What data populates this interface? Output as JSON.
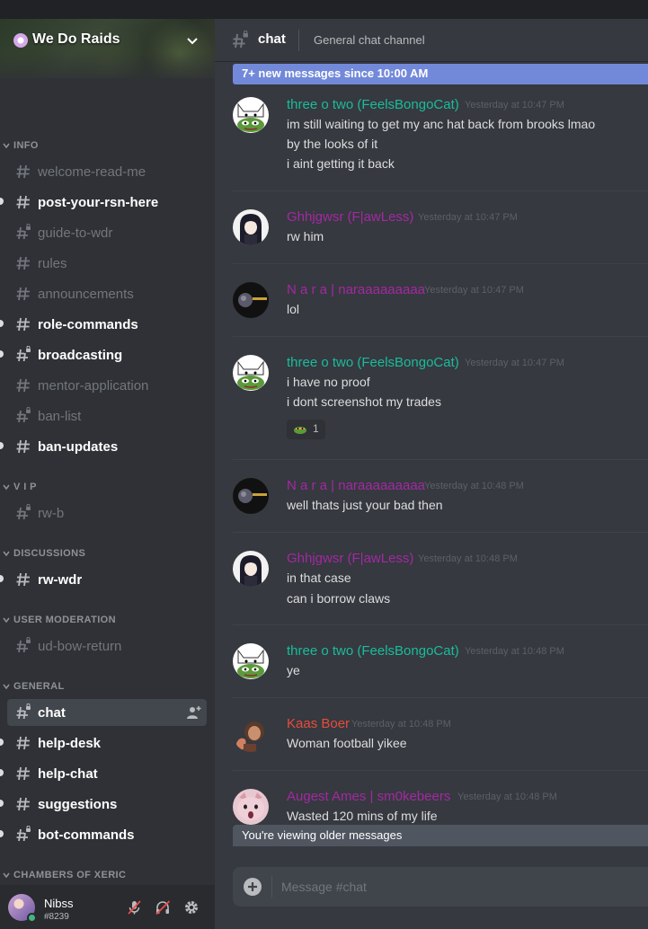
{
  "server": {
    "name": "We Do Raids"
  },
  "categories": [
    {
      "label": "INFO"
    },
    {
      "label": "V I P"
    },
    {
      "label": "DISCUSSIONS"
    },
    {
      "label": "USER MODERATION"
    },
    {
      "label": "GENERAL"
    },
    {
      "label": "CHAMBERS OF XERIC"
    }
  ],
  "channels": [
    {
      "name": "welcome-read-me",
      "unread": false
    },
    {
      "name": "post-your-rsn-here",
      "unread": true
    },
    {
      "name": "guide-to-wdr",
      "unread": false
    },
    {
      "name": "rules",
      "unread": false
    },
    {
      "name": "announcements",
      "unread": false
    },
    {
      "name": "role-commands",
      "unread": true
    },
    {
      "name": "broadcasting",
      "unread": true
    },
    {
      "name": "mentor-application",
      "unread": false
    },
    {
      "name": "ban-list",
      "unread": false
    },
    {
      "name": "ban-updates",
      "unread": true
    },
    {
      "name": "rw-b",
      "unread": false
    },
    {
      "name": "rw-wdr",
      "unread": true
    },
    {
      "name": "ud-bow-return",
      "unread": false
    },
    {
      "name": "chat",
      "unread": false,
      "selected": true
    },
    {
      "name": "help-desk",
      "unread": true
    },
    {
      "name": "help-chat",
      "unread": true
    },
    {
      "name": "suggestions",
      "unread": true
    },
    {
      "name": "bot-commands",
      "unread": true
    }
  ],
  "user": {
    "name": "Nibss",
    "tag": "#8239",
    "status": "online"
  },
  "header": {
    "channel": "chat",
    "topic": "General chat channel"
  },
  "new_messages_bar": "7+ new messages since 10:00 AM",
  "messages": [
    {
      "author": "three o two (FeelsBongoCat)",
      "color": "#1abc9c",
      "time": "Yesterday at 10:47 PM",
      "avatar": "pepe-cat",
      "lines": [
        "im still waiting to get my anc hat back from brooks lmao",
        "by the looks of it",
        "i aint getting it back"
      ]
    },
    {
      "author": "Ghhjgwsr (F|awLess)",
      "color": "#a428a4",
      "time": "Yesterday at 10:47 PM",
      "avatar": "anime-girl",
      "lines": [
        "rw him"
      ]
    },
    {
      "author": "N a r a | naraaaaaaaaa",
      "color": "#a428a4",
      "time": "Yesterday at 10:47 PM",
      "avatar": "dark-scene",
      "lines": [
        "lol"
      ]
    },
    {
      "author": "three o two (FeelsBongoCat)",
      "color": "#1abc9c",
      "time": "Yesterday at 10:47 PM",
      "avatar": "pepe-cat",
      "lines": [
        "i have no proof",
        "i dont screenshot my trades"
      ],
      "reaction": {
        "emoji": "frog-emoji",
        "count": "1"
      }
    },
    {
      "author": "N a r a | naraaaaaaaaa",
      "color": "#a428a4",
      "time": "Yesterday at 10:48 PM",
      "avatar": "dark-scene",
      "lines": [
        "well thats just your bad then"
      ]
    },
    {
      "author": "Ghhjgwsr (F|awLess)",
      "color": "#a428a4",
      "time": "Yesterday at 10:48 PM",
      "avatar": "anime-girl",
      "lines": [
        "in that case",
        "can i borrow claws"
      ]
    },
    {
      "author": "three o two (FeelsBongoCat)",
      "color": "#1abc9c",
      "time": "Yesterday at 10:48 PM",
      "avatar": "pepe-cat",
      "lines": [
        "ye"
      ]
    },
    {
      "author": "Kaas Boer",
      "color": "#e74c3c",
      "time": "Yesterday at 10:48 PM",
      "avatar": "kaas-boer",
      "lines": [
        "Woman football yikee"
      ]
    },
    {
      "author": "Augest Ames | sm0kebeers",
      "color": "#a428a4",
      "time": "Yesterday at 10:48 PM",
      "avatar": "pink-cat",
      "lines": [
        "Wasted 120 mins of my life"
      ]
    }
  ],
  "older_bar": "You're viewing older messages",
  "composer": {
    "placeholder": "Message #chat"
  },
  "colors": {
    "blurple": "#7289da",
    "online": "#43b581",
    "teal_role": "#1abc9c",
    "purple_role": "#a428a4",
    "red_role": "#e74c3c"
  }
}
